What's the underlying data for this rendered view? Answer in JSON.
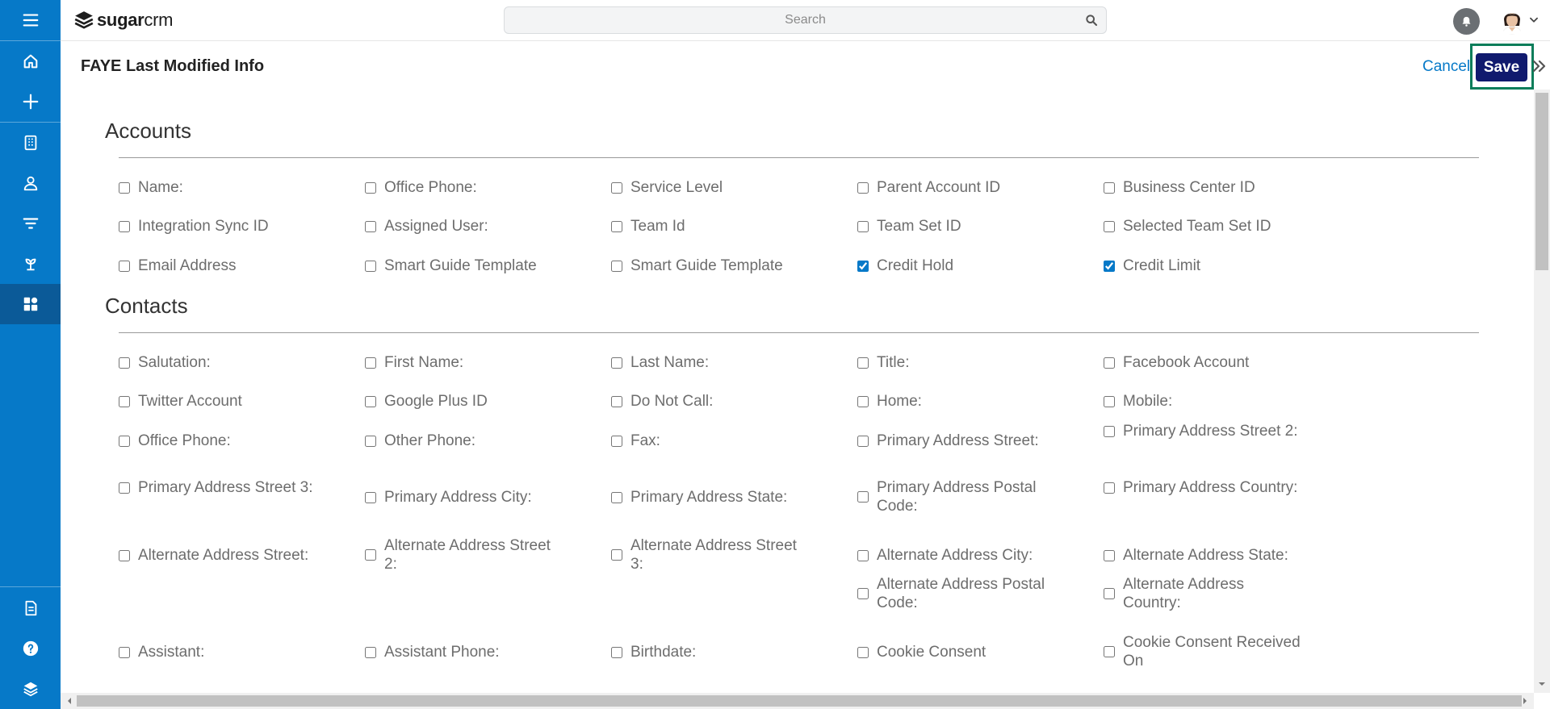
{
  "app": {
    "logo_bold": "sugar",
    "logo_light": "crm"
  },
  "search": {
    "placeholder": "Search"
  },
  "page": {
    "title": "FAYE Last Modified Info",
    "cancel_label": "Cancel",
    "save_label": "Save"
  },
  "colors": {
    "sidebar": "#0679c8",
    "sidebar_active": "#0b5a98",
    "save_button": "#101a6e",
    "save_highlight": "#0a7d5a",
    "link": "#0679c8"
  },
  "sidebar": {
    "items": [
      {
        "icon": "menu-icon"
      },
      {
        "icon": "home-icon"
      },
      {
        "icon": "plus-icon"
      },
      {
        "icon": "building-icon"
      },
      {
        "icon": "contact-icon"
      },
      {
        "icon": "filter-icon"
      },
      {
        "icon": "plant-icon"
      },
      {
        "icon": "dashboard-icon",
        "active": true
      },
      {
        "icon": "document-icon"
      },
      {
        "icon": "help-icon"
      },
      {
        "icon": "layers-icon"
      }
    ]
  },
  "sections": {
    "accounts": {
      "title": "Accounts",
      "fields": [
        {
          "label": "Name:",
          "checked": false
        },
        {
          "label": "Office Phone:",
          "checked": false
        },
        {
          "label": "Service Level",
          "checked": false
        },
        {
          "label": "Parent Account ID",
          "checked": false
        },
        {
          "label": "Business Center ID",
          "checked": false
        },
        {
          "label": "Integration Sync ID",
          "checked": false
        },
        {
          "label": "Assigned User:",
          "checked": false
        },
        {
          "label": "Team Id",
          "checked": false
        },
        {
          "label": "Team Set ID",
          "checked": false
        },
        {
          "label": "Selected Team Set ID",
          "checked": false
        },
        {
          "label": "Email Address",
          "checked": false
        },
        {
          "label": "Smart Guide Template",
          "checked": false
        },
        {
          "label": "Smart Guide Template",
          "checked": false
        },
        {
          "label": "Credit Hold",
          "checked": true
        },
        {
          "label": "Credit Limit",
          "checked": true
        }
      ]
    },
    "contacts": {
      "title": "Contacts",
      "fields": [
        {
          "label": "Salutation:",
          "checked": false
        },
        {
          "label": "First Name:",
          "checked": false
        },
        {
          "label": "Last Name:",
          "checked": false
        },
        {
          "label": "Title:",
          "checked": false
        },
        {
          "label": "Facebook Account",
          "checked": false
        },
        {
          "label": "Twitter Account",
          "checked": false
        },
        {
          "label": "Google Plus ID",
          "checked": false
        },
        {
          "label": "Do Not Call:",
          "checked": false
        },
        {
          "label": "Home:",
          "checked": false
        },
        {
          "label": "Mobile:",
          "checked": false
        },
        {
          "label": "Office Phone:",
          "checked": false
        },
        {
          "label": "Other Phone:",
          "checked": false
        },
        {
          "label": "Fax:",
          "checked": false
        },
        {
          "label": "Primary Address Street:",
          "checked": false
        },
        {
          "label": "Primary Address Street 2:",
          "checked": false
        },
        {
          "label": "Primary Address Street 3:",
          "checked": false
        },
        {
          "label": "Primary Address City:",
          "checked": false
        },
        {
          "label": "Primary Address State:",
          "checked": false
        },
        {
          "label": "Primary Address Postal Code:",
          "checked": false
        },
        {
          "label": "Primary Address Country:",
          "checked": false
        },
        {
          "label": "Alternate Address Street:",
          "checked": false
        },
        {
          "label": "Alternate Address Street 2:",
          "checked": false
        },
        {
          "label": "Alternate Address Street 3:",
          "checked": false
        },
        {
          "label": "Alternate Address City:",
          "checked": false
        },
        {
          "label": "Alternate Address State:",
          "checked": false
        },
        {
          "label": "Alternate Address Postal Code:",
          "checked": false
        },
        {
          "label": "Alternate Address Country:",
          "checked": false
        },
        {
          "label": "Assistant:",
          "checked": false
        },
        {
          "label": "Assistant Phone:",
          "checked": false
        },
        {
          "label": "Birthdate:",
          "checked": false
        },
        {
          "label": "Cookie Consent",
          "checked": false
        },
        {
          "label": "Cookie Consent Received On",
          "checked": false
        }
      ]
    }
  }
}
